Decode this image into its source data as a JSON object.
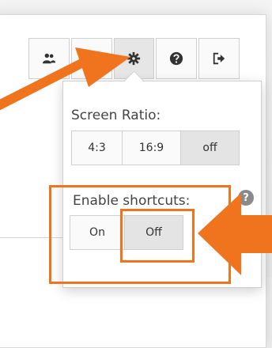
{
  "toolbar": {
    "buttons": [
      {
        "name": "users-icon"
      },
      {
        "name": "document-icon"
      },
      {
        "name": "gear-icon"
      },
      {
        "name": "help-icon"
      },
      {
        "name": "logout-icon"
      }
    ]
  },
  "settings": {
    "screen_ratio_label": "Screen Ratio:",
    "screen_ratio_options": [
      "4:3",
      "16:9",
      "off"
    ],
    "screen_ratio_selected": "off",
    "shortcuts_label": "Enable shortcuts:",
    "shortcuts_options": [
      "On",
      "Off"
    ],
    "shortcuts_selected": "Off"
  },
  "annotation": {
    "color": "#f0741e"
  }
}
